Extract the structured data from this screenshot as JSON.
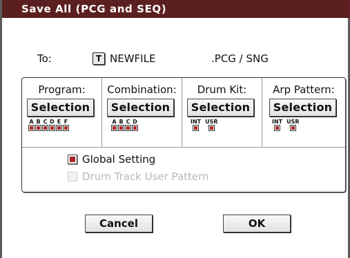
{
  "dialog": {
    "title": "Save All (PCG and SEQ)"
  },
  "destination": {
    "label": "To:",
    "text_icon": "T",
    "filename": "NEWFILE",
    "extension": ".PCG / SNG"
  },
  "columns": [
    {
      "label": "Program:",
      "button": "Selection",
      "slots": [
        "A",
        "B",
        "C",
        "D",
        "E",
        "F"
      ]
    },
    {
      "label": "Combination:",
      "button": "Selection",
      "slots": [
        "A",
        "B",
        "C",
        "D"
      ]
    },
    {
      "label": "Drum Kit:",
      "button": "Selection",
      "slots": [
        "INT",
        "USR"
      ]
    },
    {
      "label": "Arp Pattern:",
      "button": "Selection",
      "slots": [
        "INT",
        "USR"
      ]
    }
  ],
  "options": {
    "global_setting": {
      "label": "Global Setting",
      "checked": true,
      "enabled": true
    },
    "drum_track": {
      "label": "Drum Track User Pattern",
      "checked": false,
      "enabled": false
    }
  },
  "buttons": {
    "cancel": "Cancel",
    "ok": "OK"
  },
  "colors": {
    "title_bar": "#5b1f1f",
    "check_fill": "#a82626"
  }
}
